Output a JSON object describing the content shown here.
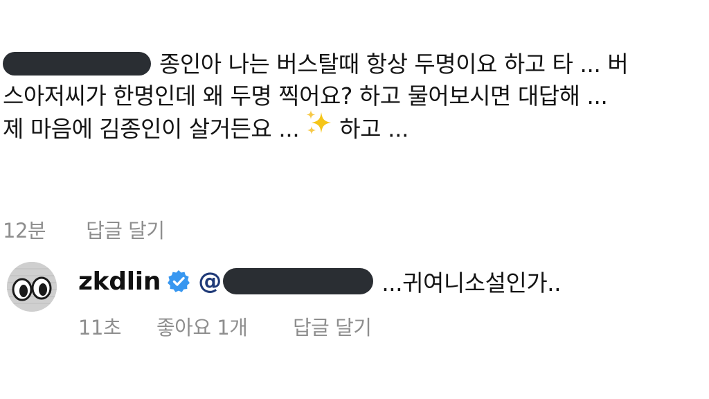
{
  "comment": {
    "lines": [
      "종인아 나는 버스탈때 항상 두명이요 하고 타 ... 버",
      "스아저씨가 한명인데 왜 두명 찍어요? 하고 물어보시면 대답해 ...",
      "제 마음에 김종인이 살거든요 ...",
      "하고 ..."
    ],
    "time": "12분",
    "reply_label": "답글 달기",
    "sparkle_icon": "sparkles-emoji-icon"
  },
  "reply": {
    "username": "zkdlin",
    "verified_icon": "verified-badge-icon",
    "mention_prefix": "@",
    "text": "...귀여니소설인가..",
    "time": "11초",
    "likes": "좋아요 1개",
    "reply_label": "답글 달기"
  },
  "colors": {
    "redaction": "#2a2e33",
    "meta_text": "#8e8e8e",
    "verified": "#3897f0",
    "sparkle": "#f5c518"
  }
}
